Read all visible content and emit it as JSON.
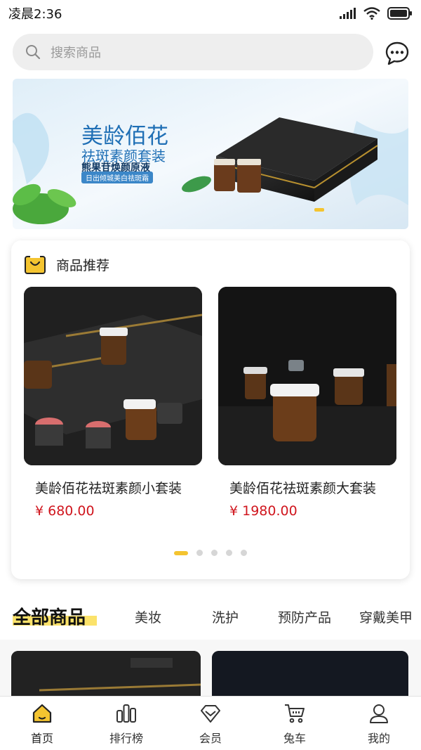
{
  "status_bar": {
    "time": "凌晨2:36",
    "icons": [
      "signal-icon",
      "wifi-icon",
      "battery-icon"
    ]
  },
  "search": {
    "placeholder": "搜索商品",
    "icon": "search-icon"
  },
  "header_actions": {
    "chat_icon": "chat-bubble-icon"
  },
  "banner": {
    "title": "美龄佰花",
    "subtitle": "祛斑素颜套装",
    "line": "熊果苷焕颜原液",
    "tag": "日出倾城美白祛斑霜"
  },
  "recommend": {
    "title": "商品推荐",
    "icon": "shopping-bag-icon",
    "products": [
      {
        "name": "美龄佰花祛斑素颜小套装",
        "price": "¥ 680.00"
      },
      {
        "name": "美龄佰花祛斑素颜大套装",
        "price": "¥ 1980.00"
      }
    ],
    "pager_count": 5,
    "pager_active": 0
  },
  "categories": {
    "main": "全部商品",
    "tabs": [
      "美妆",
      "洗护",
      "预防产品",
      "穿戴美甲"
    ]
  },
  "tabbar": {
    "items": [
      {
        "label": "首页",
        "icon": "home-icon",
        "active": true
      },
      {
        "label": "排行榜",
        "icon": "ranking-icon",
        "active": false
      },
      {
        "label": "会员",
        "icon": "diamond-icon",
        "active": false
      },
      {
        "label": "兔车",
        "icon": "cart-icon",
        "active": false
      },
      {
        "label": "我的",
        "icon": "user-icon",
        "active": false
      }
    ]
  },
  "colors": {
    "accent": "#f4c430",
    "price": "#d0161e",
    "banner_text": "#1f6fb5"
  }
}
